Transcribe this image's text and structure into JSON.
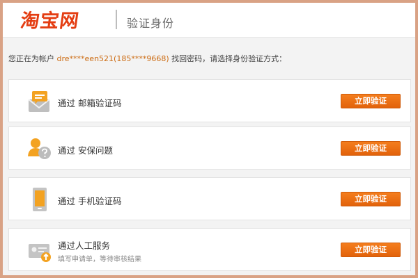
{
  "header": {
    "logo": "淘宝网",
    "title": "验证身份"
  },
  "prompt": {
    "before": "您正在为帐户 ",
    "account": "dre****een521(185****9668)",
    "after": " 找回密码，请选择身份验证方式："
  },
  "options": [
    {
      "prefix": "通过",
      "label": "邮箱验证码",
      "button": "立即验证",
      "icon": "email-icon"
    },
    {
      "prefix": "通过",
      "label": "安保问题",
      "button": "立即验证",
      "icon": "security-question-icon"
    },
    {
      "prefix": "通过",
      "label": "手机验证码",
      "button": "立即验证",
      "icon": "phone-icon"
    },
    {
      "prefix": "通过",
      "label": "人工服务",
      "sub": "填写申请单，等待审核结果",
      "button": "立即验证",
      "icon": "manual-service-icon"
    }
  ],
  "colors": {
    "accent": "#e8690f",
    "brand": "#e43d12",
    "account": "#cc6b12"
  }
}
